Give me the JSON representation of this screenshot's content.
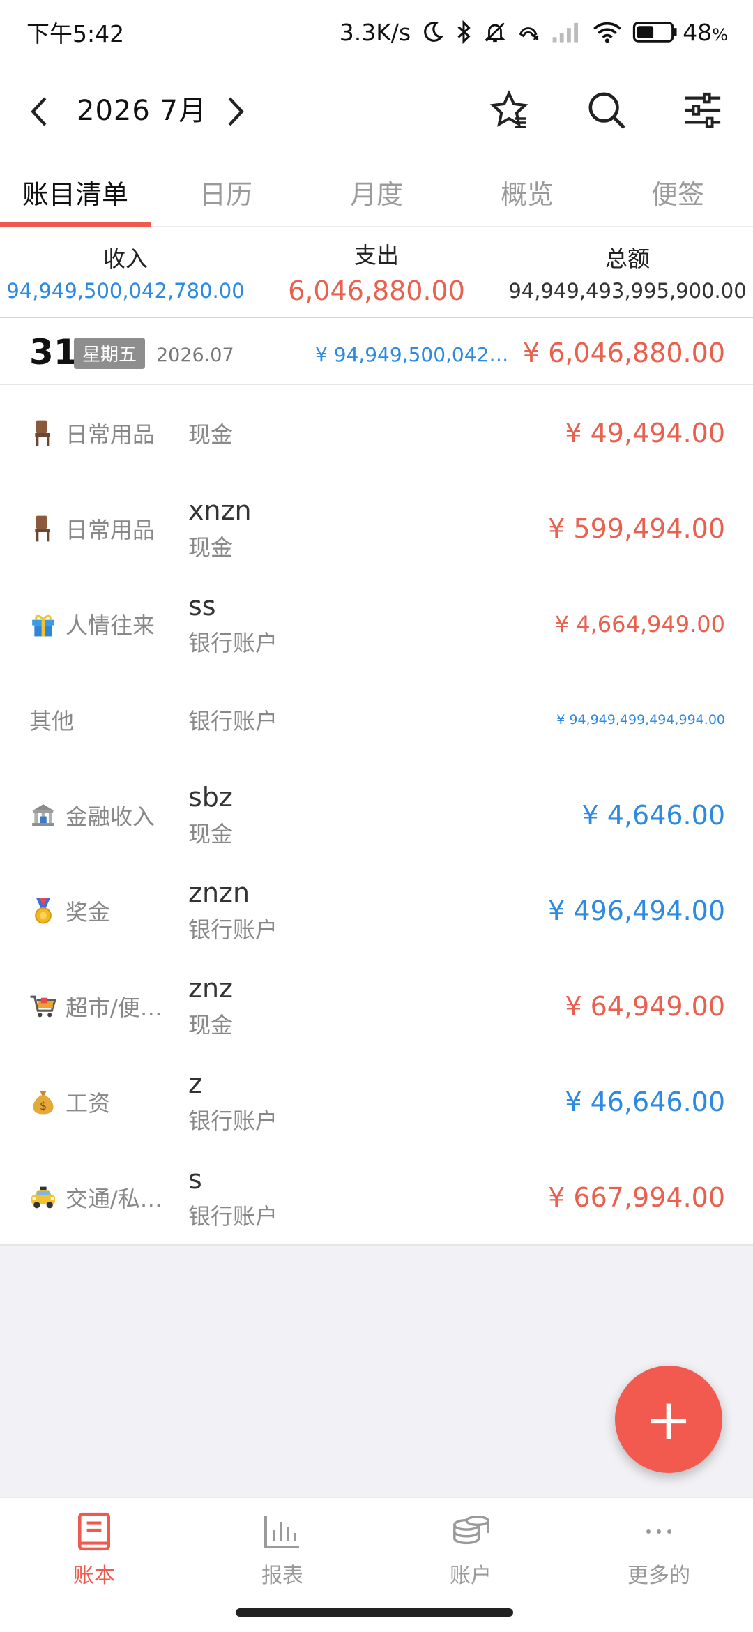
{
  "status_bar": {
    "time": "下午5:42",
    "speed": "3.3K/s",
    "battery": "48",
    "battery_unit": "%"
  },
  "header": {
    "title": "2026 7月"
  },
  "tabs": [
    {
      "label": "账目清单",
      "active": true
    },
    {
      "label": "日历"
    },
    {
      "label": "月度"
    },
    {
      "label": "概览"
    },
    {
      "label": "便签"
    }
  ],
  "summary": {
    "income_label": "收入",
    "income_value": "94,949,500,042,780.00",
    "expense_label": "支出",
    "expense_value": "6,046,880.00",
    "total_label": "总额",
    "total_value": "94,949,493,995,900.00"
  },
  "day": {
    "number": "31",
    "weekday": "星期五",
    "year_month": "2026.07",
    "income": "¥ 94,949,500,042,...",
    "expense": "¥ 6,046,880.00"
  },
  "entries": [
    {
      "icon": "chair-icon",
      "category": "日常用品",
      "note": "",
      "account": "现金",
      "amount": "¥ 49,494.00",
      "type": "expense"
    },
    {
      "icon": "chair-icon",
      "category": "日常用品",
      "note": "xnzn",
      "account": "现金",
      "amount": "¥ 599,494.00",
      "type": "expense"
    },
    {
      "icon": "gift-icon",
      "category": "人情往来",
      "note": "ss",
      "account": "银行账户",
      "amount": "¥ 4,664,949.00",
      "type": "expense"
    },
    {
      "icon": "",
      "category": "其他",
      "note": "",
      "account": "银行账户",
      "amount": "¥ 94,949,499,494,994.00",
      "type": "income"
    },
    {
      "icon": "bank-icon",
      "category": "金融收入",
      "note": "sbz",
      "account": "现金",
      "amount": "¥ 4,646.00",
      "type": "income"
    },
    {
      "icon": "medal-icon",
      "category": "奖金",
      "note": "znzn",
      "account": "银行账户",
      "amount": "¥ 496,494.00",
      "type": "income"
    },
    {
      "icon": "cart-icon",
      "category": "超市/便…",
      "note": "znz",
      "account": "现金",
      "amount": "¥ 64,949.00",
      "type": "expense"
    },
    {
      "icon": "money-bag-icon",
      "category": "工资",
      "note": "z",
      "account": "银行账户",
      "amount": "¥ 46,646.00",
      "type": "income"
    },
    {
      "icon": "taxi-icon",
      "category": "交通/私…",
      "note": "s",
      "account": "银行账户",
      "amount": "¥ 667,994.00",
      "type": "expense"
    }
  ],
  "fab": {
    "label": "+"
  },
  "bottom_nav": [
    {
      "label": "账本",
      "icon": "book-icon",
      "active": true
    },
    {
      "label": "报表",
      "icon": "bar-chart-icon"
    },
    {
      "label": "账户",
      "icon": "coins-icon"
    },
    {
      "label": "更多的",
      "icon": "more-icon"
    }
  ],
  "colors": {
    "accent": "#ef5a4f",
    "income": "#2d8ae0",
    "expense": "#e8614f"
  }
}
